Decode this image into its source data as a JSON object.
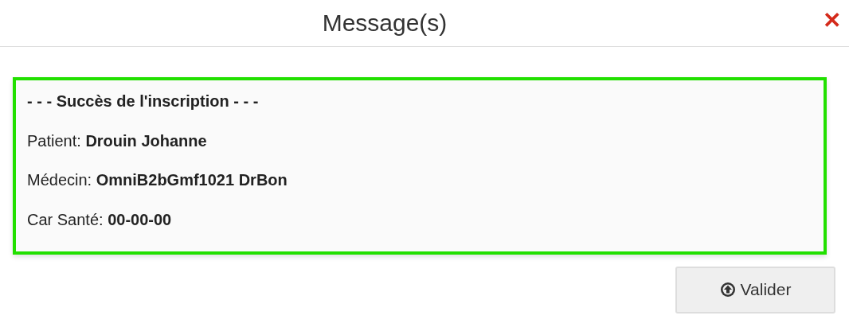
{
  "dialog": {
    "title": "Message(s)",
    "close": "✕"
  },
  "message": {
    "heading": "- - - Succès de l'inscription - - -",
    "lines": [
      "Patient: **Drouin Johanne**",
      "Médecin: **OmniB2bGmf1021 DrBon**",
      "Car Santé: **00-00-00**"
    ]
  },
  "buttons": [
    {
      "label": "Valider"
    }
  ]
}
